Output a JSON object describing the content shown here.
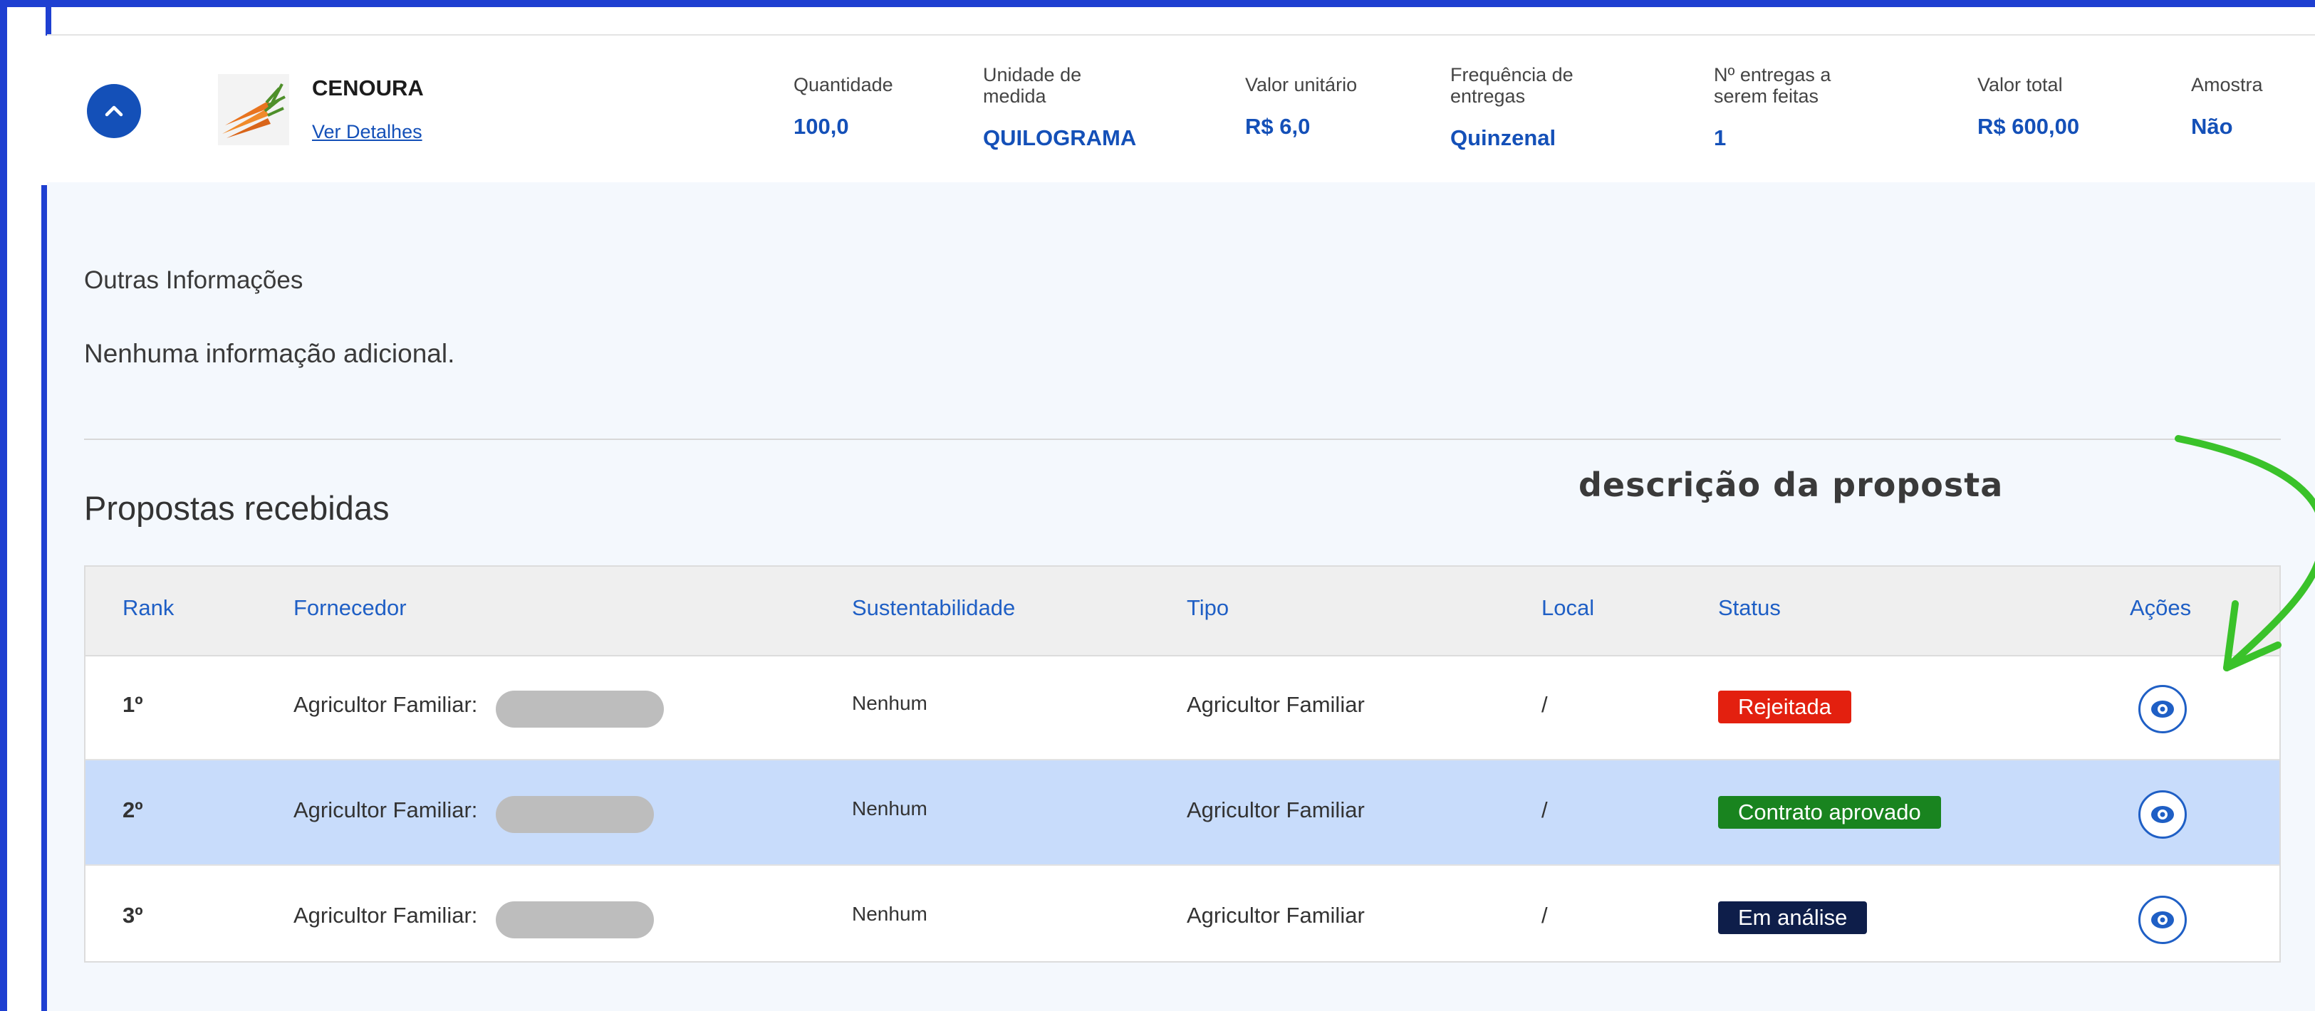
{
  "item": {
    "name": "CENOURA",
    "details_link": "Ver Detalhes",
    "fields": [
      {
        "label": "Quantidade",
        "value": "100,0"
      },
      {
        "label": "Unidade de medida",
        "value": "QUILOGRAMA"
      },
      {
        "label": "Valor unitário",
        "value": "R$ 6,0"
      },
      {
        "label": "Frequência de entregas",
        "value": "Quinzenal"
      },
      {
        "label": "Nº entregas a serem feitas",
        "value": "1"
      },
      {
        "label": "Valor total",
        "value": "R$ 600,00"
      },
      {
        "label": "Amostra",
        "value": "Não"
      }
    ]
  },
  "other_info": {
    "label": "Outras Informações",
    "text": "Nenhuma informação adicional."
  },
  "proposals": {
    "title": "Propostas recebidas",
    "annotation": "descrição da proposta",
    "columns": [
      "Rank",
      "Fornecedor",
      "Sustentabilidade",
      "Tipo",
      "Local",
      "Status",
      "Ações"
    ],
    "rows": [
      {
        "rank": "1º",
        "supplier": "Agricultor Familiar:",
        "sustainability": "Nenhum",
        "type": "Agricultor Familiar",
        "location": "/",
        "status": "Rejeitada",
        "status_color": "#e3200f",
        "highlight": false
      },
      {
        "rank": "2º",
        "supplier": "Agricultor Familiar:",
        "sustainability": "Nenhum",
        "type": "Agricultor Familiar",
        "location": "/",
        "status": "Contrato aprovado",
        "status_color": "#19841f",
        "highlight": true
      },
      {
        "rank": "3º",
        "supplier": "Agricultor Familiar:",
        "sustainability": "Nenhum",
        "type": "Agricultor Familiar",
        "location": "/",
        "status": "Em análise",
        "status_color": "#0e1e4a",
        "highlight": false
      }
    ]
  },
  "colors": {
    "frame": "#1e3fd1",
    "primary": "#1450b8",
    "row_highlight": "#c8dcfb",
    "annotation_arrow": "#3ac22a"
  },
  "icons": {
    "collapse": "chevron-up-icon",
    "view": "eye-icon",
    "product": "carrot-image"
  }
}
